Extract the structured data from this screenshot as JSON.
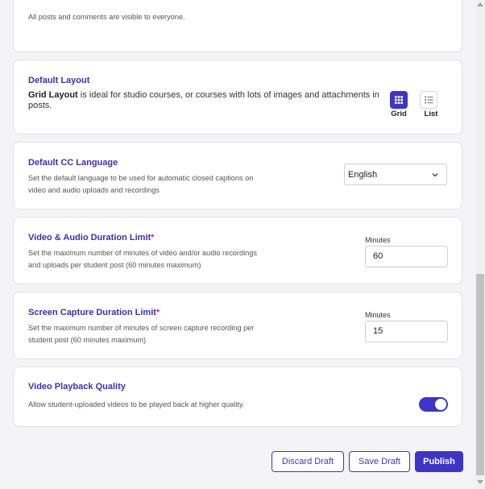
{
  "visibility": {
    "description": "All posts and comments are visible to everyone."
  },
  "default_layout": {
    "title": "Default Layout",
    "lead": "Grid Layout",
    "description": " is ideal for studio courses, or courses with lots of images and attachments in posts.",
    "options": [
      {
        "label": "Grid",
        "icon": "grid-icon",
        "selected": true
      },
      {
        "label": "List",
        "icon": "list-icon",
        "selected": false
      }
    ]
  },
  "cc_language": {
    "title": "Default CC Language",
    "description": "Set the default language to be used for automatic closed captions on video and audio uploads and recordings",
    "selected": "English"
  },
  "video_audio_limit": {
    "title": "Video & Audio Duration Limit",
    "required_mark": "*",
    "description": "Set the maximum number of minutes of video and/or audio recordings and uploads per student post (60 minutes maximum)",
    "field_label": "Minutes",
    "value": "60"
  },
  "screen_capture_limit": {
    "title": "Screen Capture Duration Limit",
    "required_mark": "*",
    "description": "Set the maximum number of minutes of screen capture recording per student post (60 minutes maximum)",
    "field_label": "Minutes",
    "value": "15"
  },
  "playback_quality": {
    "title": "Video Playback Quality",
    "description": "Allow student-uploaded videos to be played back at higher quality.",
    "enabled": true
  },
  "actions": {
    "discard": "Discard Draft",
    "save": "Save Draft",
    "publish": "Publish"
  },
  "colors": {
    "accent": "#3f34c8",
    "title": "#3b2fb8",
    "required": "#e0284a"
  }
}
